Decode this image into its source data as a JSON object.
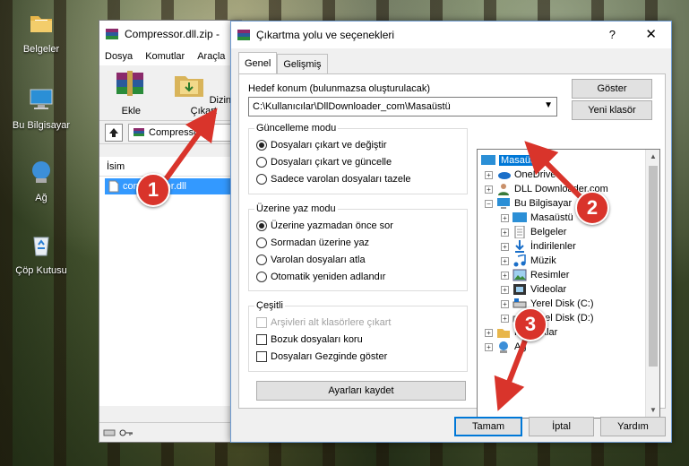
{
  "desktop": {
    "icons": [
      {
        "label": "Belgeler",
        "icon": "folder-documents-icon"
      },
      {
        "label": "Bu Bilgisayar",
        "icon": "computer-icon"
      },
      {
        "label": "Ağ",
        "icon": "network-icon"
      },
      {
        "label": "Çöp Kutusu",
        "icon": "recycle-bin-icon"
      }
    ]
  },
  "rar_window": {
    "title": "Compressor.dll.zip -",
    "menu": [
      "Dosya",
      "Komutlar",
      "Araçla"
    ],
    "toolbar": [
      "Ekle",
      "Dizine Çıkart"
    ],
    "address": "Compressor",
    "column_name": "İsim",
    "file": "compressor.dll"
  },
  "dialog": {
    "title": "Çıkartma yolu ve seçenekleri",
    "help": "?",
    "close": "✕",
    "tabs": [
      "Genel",
      "Gelişmiş"
    ],
    "dest_label": "Hedef konum (bulunmazsa oluşturulacak)",
    "dest_value": "C:\\Kullanıcılar\\DllDownloader_com\\Masaüstü",
    "show_button": "Göster",
    "new_folder_button": "Yeni klasör",
    "update_mode": {
      "title": "Güncelleme modu",
      "options": [
        "Dosyaları çıkart ve değiştir",
        "Dosyaları çıkart ve güncelle",
        "Sadece varolan dosyaları tazele"
      ],
      "selected": 0
    },
    "overwrite_mode": {
      "title": "Üzerine yaz modu",
      "options": [
        "Üzerine yazmadan önce sor",
        "Sormadan üzerine yaz",
        "Varolan dosyaları atla",
        "Otomatik yeniden adlandır"
      ],
      "selected": 0
    },
    "misc": {
      "title": "Çeşitli",
      "options": [
        "Arşivleri alt klasörlere çıkart",
        "Bozuk dosyaları koru",
        "Dosyaları Gezginde göster"
      ]
    },
    "save_settings": "Ayarları kaydet",
    "tree": [
      {
        "label": "Masaüstü",
        "icon": "desktop-icon",
        "selected": true
      },
      {
        "label": "OneDrive",
        "icon": "onedrive-icon"
      },
      {
        "label": "DLL Downloader.com",
        "icon": "user-icon"
      },
      {
        "label": "Bu Bilgisayar",
        "icon": "computer-icon"
      },
      {
        "label": "Masaüstü",
        "icon": "desktop-icon"
      },
      {
        "label": "Belgeler",
        "icon": "documents-icon"
      },
      {
        "label": "İndirilenler",
        "icon": "downloads-icon"
      },
      {
        "label": "Müzik",
        "icon": "music-icon"
      },
      {
        "label": "Resimler",
        "icon": "pictures-icon"
      },
      {
        "label": "Videolar",
        "icon": "videos-icon"
      },
      {
        "label": "Yerel Disk (C:)",
        "icon": "drive-icon"
      },
      {
        "label": "Yerel Disk (D:)",
        "icon": "drive-icon"
      },
      {
        "label": "Kitaplıklar",
        "icon": "libraries-icon"
      },
      {
        "label": "Ağ",
        "icon": "network-icon"
      }
    ],
    "ok": "Tamam",
    "cancel": "İptal",
    "help_button": "Yardım"
  },
  "callouts": [
    "1",
    "2",
    "3"
  ],
  "colors": {
    "accent": "#0078d7",
    "callout": "#d9342b"
  }
}
